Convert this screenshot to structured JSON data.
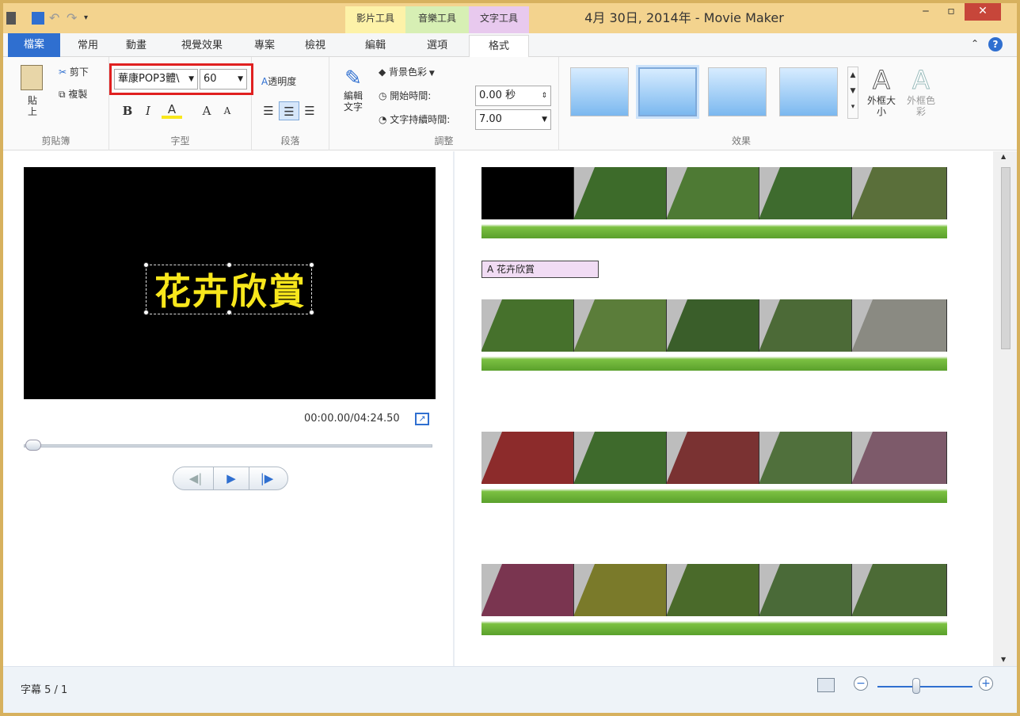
{
  "window": {
    "title": "4月 30日, 2014年 - Movie Maker",
    "minimize": "‒",
    "maximize": "▫",
    "close": "✕"
  },
  "context_groups": [
    {
      "label": "影片工具",
      "color": "#fdf2a8"
    },
    {
      "label": "音樂工具",
      "color": "#d7efb4"
    },
    {
      "label": "文字工具",
      "color": "#e8c9ee"
    }
  ],
  "tabs": [
    {
      "label": "檔案"
    },
    {
      "label": "常用"
    },
    {
      "label": "動畫"
    },
    {
      "label": "視覺效果"
    },
    {
      "label": "專案"
    },
    {
      "label": "檢視"
    },
    {
      "label": "編輯"
    },
    {
      "label": "選項"
    },
    {
      "label": "格式"
    }
  ],
  "ribbon": {
    "clipboard": {
      "paste": "貼上",
      "cut": "剪下",
      "copy": "複製",
      "group": "剪貼簿"
    },
    "font": {
      "font_name": "華康POP3體\\",
      "font_size": "60",
      "bold": "B",
      "italic": "I",
      "color": "A",
      "grow": "A",
      "shrink": "A",
      "group": "字型"
    },
    "paragraph": {
      "transparency": "透明度",
      "group": "段落"
    },
    "adjust": {
      "edit_text": "編輯文字",
      "bg_color": "背景色彩",
      "start_time_label": "開始時間:",
      "start_time_value": "0.00 秒",
      "duration_label": "文字持續時間:",
      "duration_value": "7.00",
      "group": "調整"
    },
    "effects": {
      "outline_size": "外框大小",
      "outline_color": "外框色彩",
      "group": "效果"
    }
  },
  "preview": {
    "overlay_text": "花卉欣賞",
    "timecode": "00:00.00/04:24.50"
  },
  "storyboard": {
    "caption": "花卉欣賞"
  },
  "status": {
    "text": "字幕 5 / 1"
  },
  "colors": {
    "accent": "#2f6fd0",
    "titlebar": "#f3d38e",
    "caption_bg": "#f1dcf4",
    "overlay_text": "#f8e71c"
  }
}
